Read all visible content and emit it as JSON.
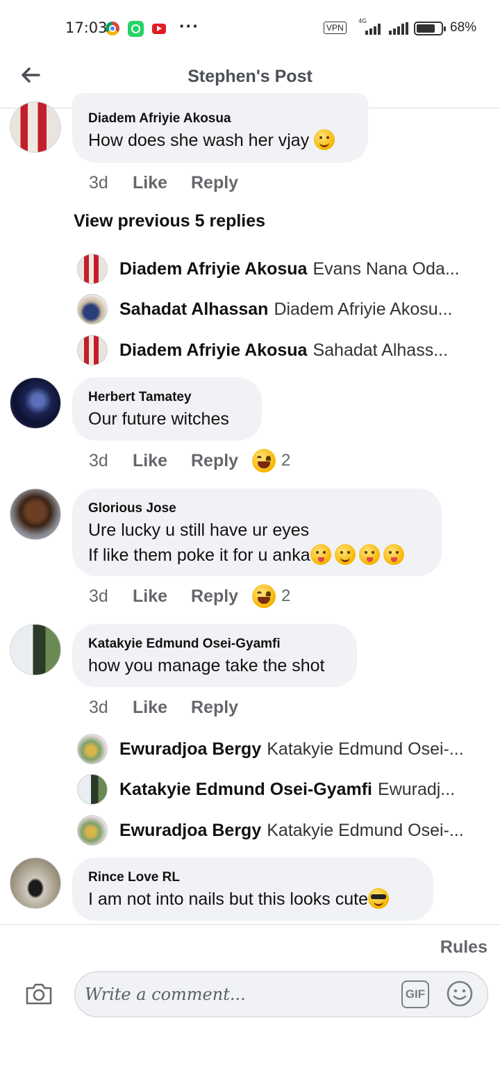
{
  "status_bar": {
    "time": "17:03",
    "vpn": "VPN",
    "network": "4G",
    "battery": "68%"
  },
  "header": {
    "title": "Stephen's Post"
  },
  "comments": [
    {
      "author": "Diadem Afriyie Akosua",
      "lines": [
        "How does she wash her vjay"
      ],
      "time": "3d",
      "like": "Like",
      "reply": "Reply"
    },
    {
      "author": "Herbert Tamatey",
      "lines": [
        "Our future witches"
      ],
      "time": "3d",
      "like": "Like",
      "reply": "Reply",
      "reactions": "2"
    },
    {
      "author": "Glorious Jose",
      "lines": [
        "Ure lucky u still have ur eyes",
        "If like them poke it for u anka"
      ],
      "time": "3d",
      "like": "Like",
      "reply": "Reply",
      "reactions": "2"
    },
    {
      "author": "Katakyie Edmund Osei-Gyamfi",
      "lines": [
        "how you manage take the shot"
      ],
      "time": "3d",
      "like": "Like",
      "reply": "Reply"
    },
    {
      "author": "Rince Love RL",
      "lines": [
        "I am not into nails but this looks cute"
      ]
    }
  ],
  "view_previous": "View previous 5 replies",
  "replies_group_1": [
    {
      "name": "Diadem Afriyie Akosua",
      "text": "Evans Nana Oda..."
    },
    {
      "name": "Sahadat Alhassan",
      "text": "Diadem Afriyie Akosu..."
    },
    {
      "name": "Diadem Afriyie Akosua",
      "text": "Sahadat Alhass..."
    }
  ],
  "replies_group_2": [
    {
      "name": "Ewuradjoa Bergy",
      "text": "Katakyie Edmund Osei-..."
    },
    {
      "name": "Katakyie Edmund Osei-Gyamfi",
      "text": "Ewuradj..."
    },
    {
      "name": "Ewuradjoa Bergy",
      "text": "Katakyie Edmund Osei-..."
    }
  ],
  "footer": {
    "rules": "Rules",
    "placeholder": "Write a comment...",
    "gif": "GIF"
  },
  "colors": {
    "bubble": "#f0f2f5",
    "muted": "#65676b",
    "text": "#111111"
  },
  "icons": [
    "back-arrow-icon",
    "camera-icon",
    "gif-icon",
    "emoji-icon",
    "chrome-icon",
    "whatsapp-icon",
    "youtube-icon"
  ]
}
